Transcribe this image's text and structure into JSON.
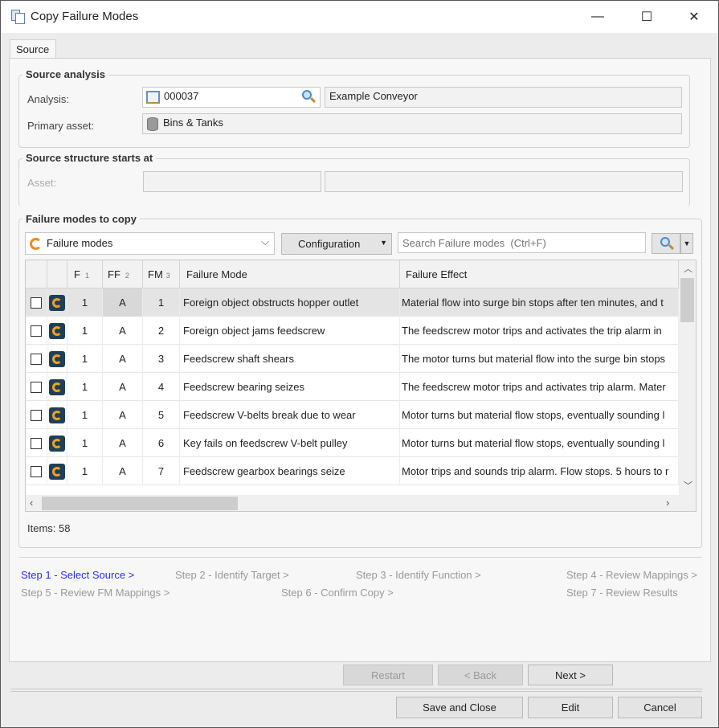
{
  "window": {
    "title": "Copy Failure Modes",
    "minimize": "—",
    "maximize": "☐",
    "close": "✕"
  },
  "tabs": [
    {
      "label": "Source"
    }
  ],
  "source_analysis": {
    "title": "Source analysis",
    "analysis_label": "Analysis:",
    "analysis_id": "000037",
    "analysis_name": "Example Conveyor",
    "primary_asset_label": "Primary asset:",
    "primary_asset": "Bins & Tanks"
  },
  "source_structure": {
    "title": "Source structure starts at",
    "asset_label": "Asset:",
    "asset_id": "",
    "asset_name": ""
  },
  "failure_modes": {
    "title": "Failure modes to copy",
    "dropdown_value": "Failure modes",
    "configuration_label": "Configuration",
    "search_placeholder": "Search Failure modes  (Ctrl+F)",
    "items_label": "Items: 58"
  },
  "grid": {
    "columns": [
      {
        "label": ""
      },
      {
        "label": ""
      },
      {
        "label": "F",
        "sort": "1"
      },
      {
        "label": "FF",
        "sort": "2"
      },
      {
        "label": "FM",
        "sort": "3"
      },
      {
        "label": "Failure Mode"
      },
      {
        "label": "Failure Effect"
      }
    ],
    "rows": [
      {
        "f": "1",
        "ff": "A",
        "fm": "1",
        "mode": "Foreign object obstructs hopper outlet",
        "effect": "Material flow into surge bin stops after ten minutes, and t",
        "selected": true
      },
      {
        "f": "1",
        "ff": "A",
        "fm": "2",
        "mode": "Foreign object jams feedscrew",
        "effect": "The feedscrew motor trips and activates the trip alarm in"
      },
      {
        "f": "1",
        "ff": "A",
        "fm": "3",
        "mode": "Feedscrew shaft shears",
        "effect": "The motor turns but material flow into the surge bin stops"
      },
      {
        "f": "1",
        "ff": "A",
        "fm": "4",
        "mode": "Feedscrew bearing seizes",
        "effect": "The feedscrew motor trips and activates trip alarm. Mater"
      },
      {
        "f": "1",
        "ff": "A",
        "fm": "5",
        "mode": "Feedscrew V-belts break due to wear",
        "effect": "Motor turns but material flow stops, eventually sounding l"
      },
      {
        "f": "1",
        "ff": "A",
        "fm": "6",
        "mode": "Key fails on feedscrew V-belt pulley",
        "effect": "Motor turns but material flow stops, eventually sounding l"
      },
      {
        "f": "1",
        "ff": "A",
        "fm": "7",
        "mode": "Feedscrew gearbox bearings seize",
        "effect": "Motor trips and sounds trip alarm. Flow stops. 5 hours to r"
      }
    ]
  },
  "steps": [
    {
      "label": "Step 1 - Select Source >",
      "active": true
    },
    {
      "label": "Step 2 - Identify Target >"
    },
    {
      "label": "Step 3 - Identify Function >"
    },
    {
      "label": "Step 4 - Review Mappings >"
    },
    {
      "label": "Step 5 - Review FM Mappings >"
    },
    {
      "label": "Step 6 - Confirm Copy >"
    },
    {
      "label": "Step 7 - Review Results"
    }
  ],
  "buttons": {
    "restart": "Restart",
    "back": "< Back",
    "next": "Next >",
    "save_close": "Save and Close",
    "edit": "Edit",
    "cancel": "Cancel"
  }
}
